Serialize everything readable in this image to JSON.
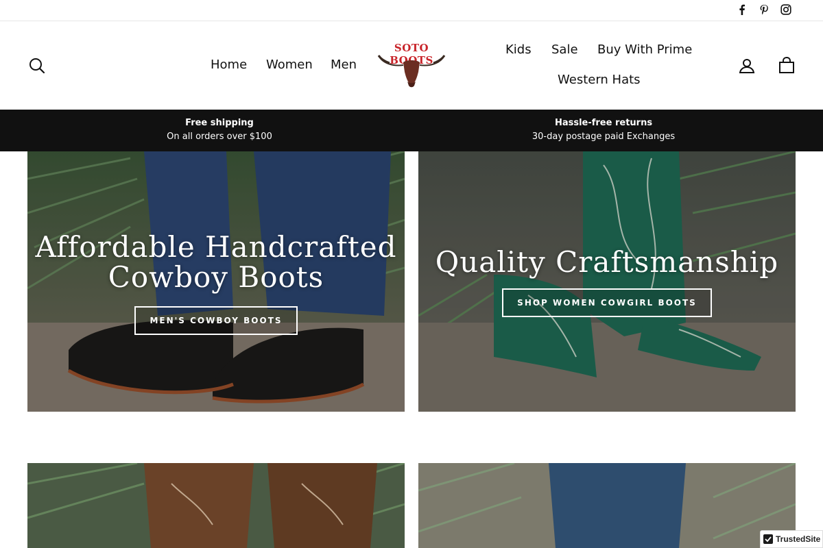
{
  "social": {
    "facebook_icon": "facebook-icon",
    "pinterest_icon": "pinterest-icon",
    "instagram_icon": "instagram-icon"
  },
  "header": {
    "nav_left": [
      "Home",
      "Women",
      "Men"
    ],
    "nav_right_row1": [
      "Kids",
      "Sale",
      "Buy With Prime"
    ],
    "nav_right_row2": [
      "Western Hats"
    ],
    "logo_text": "SOTO BOOTS",
    "search_icon": "search-icon",
    "account_icon": "user-icon",
    "cart_icon": "cart-icon"
  },
  "announcement": {
    "items": [
      {
        "title": "Free shipping",
        "subtitle": "On all orders over $100"
      },
      {
        "title": "Hassle-free returns",
        "subtitle": "30-day postage paid Exchanges"
      }
    ],
    "background": "#111111"
  },
  "promos": [
    {
      "title_line1": "Affordable Handcrafted",
      "title_line2": "Cowboy Boots",
      "button": "MEN'S COWBOY BOOTS"
    },
    {
      "title_line1": "Quality Craftsmanship",
      "title_line2": "",
      "button": "SHOP WOMEN COWGIRL BOOTS"
    }
  ],
  "trusted_badge": "TrustedSite",
  "colors": {
    "brand_red": "#c8242a",
    "text": "#111111"
  }
}
